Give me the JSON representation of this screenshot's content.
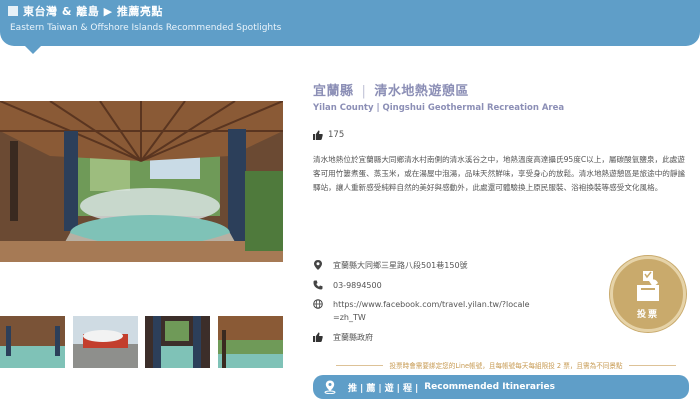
{
  "banner": {
    "title": "東台灣 & 離島 ▶ 推薦亮點",
    "subtitle": "Eastern Taiwan & Offshore Islands Recommended Spotlights"
  },
  "spot": {
    "county": "宜蘭縣",
    "name": "清水地熱遊憩區",
    "subtitle_en": "Yilan County | Qingshui Geothermal Recreation Area",
    "likes": "175",
    "description": "清水地熱位於宜蘭縣大同鄉清水村南側的清水溪谷之中，地熱溫度高達攝氏95度C以上，屬碳酸氫鹽泉，此處遊客可用竹簍煮蛋、蒸玉米，或在湯屋中泡湯，品味天然鮮味，享受身心的放鬆。清水地熱遊憩區是旅途中的靜謐驛站，讓人重新感受純粹自然的美好與感動外，此處還可體驗換上原民服裝、浴袍換裝等感受文化風格。",
    "address": "宜蘭縣大同鄉三星路八段501巷150號",
    "phone": "03-9894500",
    "website": "https://www.facebook.com/travel.yilan.tw/?locale=zh_TW",
    "organizer": "宜蘭縣政府"
  },
  "vote": {
    "label": "投票"
  },
  "notice": "投票時會需要綁定您的Line帳號，且每帳號每天每組限投 2 票，且需為不同景點",
  "itinerary": {
    "cn_chars": [
      "推",
      "薦",
      "遊",
      "程"
    ],
    "en": "Recommended Itineraries"
  },
  "colors": {
    "banner": "#5f9ec8",
    "title": "#8c8fb6",
    "vote_gold": "#c9aa6c",
    "notice": "#c79a52"
  },
  "icons": [
    "thumb-up-icon",
    "location-pin-icon",
    "phone-icon",
    "globe-icon",
    "thumb-up-icon",
    "ballot-box-icon",
    "map-pin-icon"
  ]
}
